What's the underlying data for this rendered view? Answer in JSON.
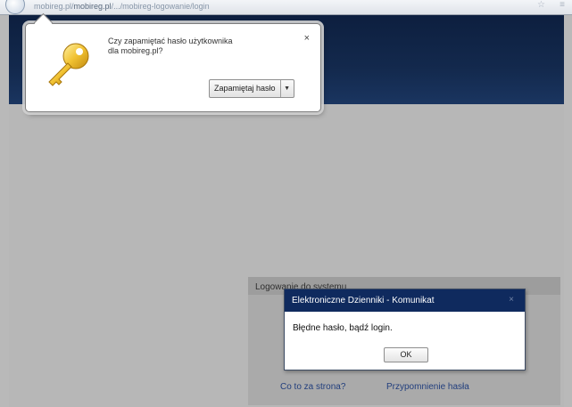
{
  "browser": {
    "url_faded_prefix": "mobireg.pl/",
    "url_domain": "mobireg.pl",
    "url_suffix": "/.../mobireg-logowanie/login",
    "star_glyph": "☆",
    "menu_glyph": "≡"
  },
  "password_prompt": {
    "message_line1": "Czy zapamiętać hasło użytkownika",
    "message_line2": "dla mobireg.pl?",
    "close_glyph": "×",
    "save_label": "Zapamiętaj hasło",
    "dropdown_glyph": "▼",
    "icon": "key-icon"
  },
  "login": {
    "title": "Logowanie do systemu",
    "link_what": "Co to za strona?",
    "link_remind": "Przypomnienie hasła"
  },
  "error_dialog": {
    "title": "Elektroniczne Dzienniki - Komunikat",
    "close_glyph": "×",
    "message": "Błędne hasło, bądź login.",
    "ok_label": "OK"
  },
  "colors": {
    "header": "#13294d",
    "dialog_titlebar": "#0f2a5e",
    "page_background": "#b7b7b7",
    "link": "#213e7d"
  }
}
